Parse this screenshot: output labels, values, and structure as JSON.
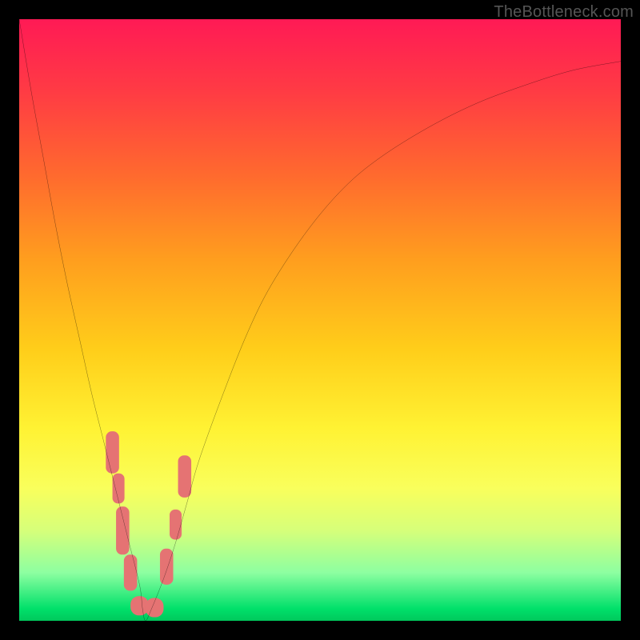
{
  "watermark": "TheBottleneck.com",
  "chart_data": {
    "type": "line",
    "title": "",
    "xlabel": "",
    "ylabel": "",
    "xlim": [
      0,
      100
    ],
    "ylim": [
      0,
      100
    ],
    "grid": false,
    "legend": false,
    "series": [
      {
        "name": "bottleneck-curve",
        "x": [
          0,
          2,
          4,
          6,
          8,
          10,
          12,
          14,
          16,
          18,
          20,
          20.5,
          21,
          22,
          24,
          26,
          28,
          30,
          34,
          38,
          42,
          48,
          54,
          60,
          68,
          76,
          84,
          92,
          100
        ],
        "y": [
          100,
          88,
          77,
          66,
          56,
          47,
          38,
          30,
          22,
          14,
          6,
          2,
          0,
          2,
          7,
          13,
          20,
          27,
          38,
          48,
          56,
          65,
          72,
          77,
          82,
          86,
          89,
          91.5,
          93
        ]
      }
    ],
    "markers": [
      {
        "name": "left-marker-1",
        "x": 15.5,
        "y": 28,
        "w": 2.2,
        "h": 7
      },
      {
        "name": "left-marker-2",
        "x": 16.5,
        "y": 22,
        "w": 2.0,
        "h": 5
      },
      {
        "name": "left-marker-3",
        "x": 17.2,
        "y": 15,
        "w": 2.2,
        "h": 8
      },
      {
        "name": "left-marker-4",
        "x": 18.5,
        "y": 8,
        "w": 2.2,
        "h": 6
      },
      {
        "name": "bottom-marker-1",
        "x": 20.0,
        "y": 2.5,
        "w": 3.0,
        "h": 3.2
      },
      {
        "name": "bottom-marker-2",
        "x": 22.5,
        "y": 2.2,
        "w": 3.0,
        "h": 3.2
      },
      {
        "name": "right-marker-1",
        "x": 24.5,
        "y": 9,
        "w": 2.2,
        "h": 6
      },
      {
        "name": "right-marker-2",
        "x": 26.0,
        "y": 16,
        "w": 2.0,
        "h": 5
      },
      {
        "name": "right-marker-3",
        "x": 27.5,
        "y": 24,
        "w": 2.2,
        "h": 7
      }
    ],
    "marker_color": "#e57373",
    "curve_color": "#000000"
  }
}
